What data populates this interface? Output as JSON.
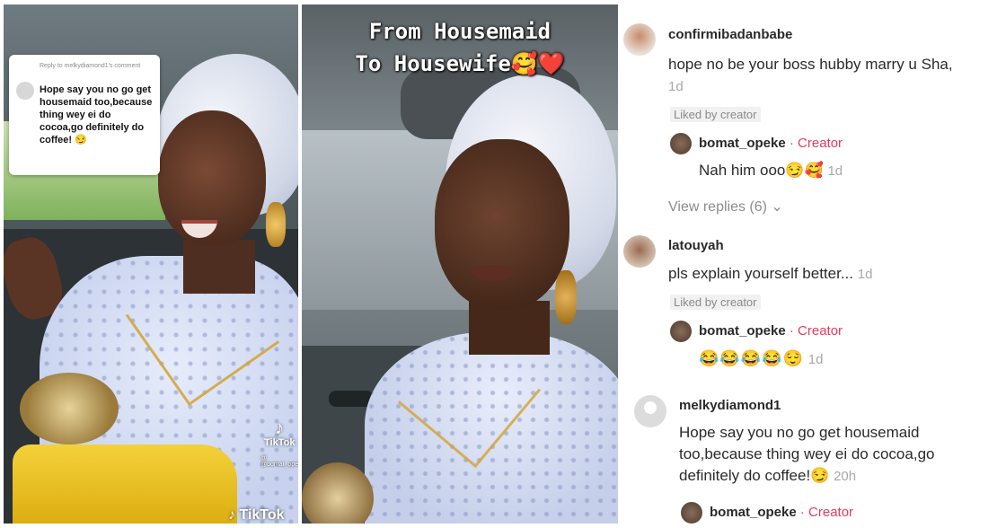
{
  "panel1": {
    "reply_header": "Reply to melkydiamond1's comment",
    "reply_text": "Hope say you no go get housemaid too,because thing wey ei do cocoa,go definitely do coffee! 😏",
    "watermark_small": "TikTok",
    "watermark_handle": "@ @bomat_opeke",
    "watermark_bottom": "TikTok",
    "tiktok_logo": "♪"
  },
  "panel2": {
    "title_line1": "From Housemaid",
    "title_line2": "To Housewife🥰❤️"
  },
  "comments": [
    {
      "username": "confirmibadanbabe",
      "text": "hope no be your boss hubby marry u Sha,",
      "time": "1d",
      "liked": "Liked by creator",
      "reply": {
        "username": "bomat_opeke",
        "tag": "· Creator",
        "text": "Nah him ooo😏🥰",
        "time": "1d"
      },
      "view_replies": "View replies (6) ⌄"
    },
    {
      "username": "latouyah",
      "text": "pls explain yourself better...",
      "time": "1d",
      "liked": "Liked by creator",
      "reply": {
        "username": "bomat_opeke",
        "tag": "· Creator",
        "text": "😂😂😂😂😌",
        "time": "1d"
      }
    },
    {
      "username": "melkydiamond1",
      "text_lines": [
        "Hope say you no go get housemaid",
        "too,because thing wey ei do cocoa,go",
        "definitely do coffee!😏"
      ],
      "time": "20h",
      "reply": {
        "username": "bomat_opeke",
        "tag": "· Creator"
      }
    }
  ],
  "colors": {
    "creator_tag": "#ea3a5c",
    "liked_bg": "#f1f1f1",
    "meta_gray": "#a8a8a8"
  }
}
